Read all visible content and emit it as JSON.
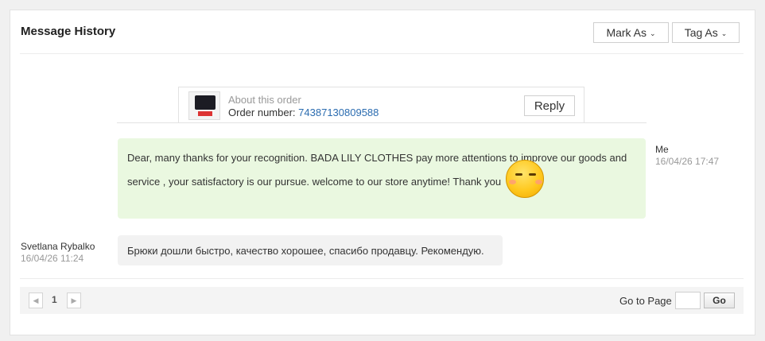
{
  "header": {
    "title": "Message History",
    "mark_as_label": "Mark As",
    "tag_as_label": "Tag As"
  },
  "order": {
    "about_label": "About this order",
    "order_number_label": "Order number:",
    "order_number": "74387130809588",
    "reply_label": "Reply"
  },
  "messages": [
    {
      "sender": "Me",
      "timestamp": "16/04/26 17:47",
      "text": "Dear, many thanks for your recognition. BADA LILY CLOTHES pay more attentions to improve our goods and service , your satisfactory is our pursue. welcome to our store anytime! Thank you",
      "icon": "smiley-emoji-icon"
    },
    {
      "sender": "Svetlana Rybalko",
      "timestamp": "16/04/26 11:24",
      "text": "Брюки дошли быстро, качество хорошее, спасибо продавцу. Рекомендую."
    }
  ],
  "pagination": {
    "current_page": "1",
    "goto_label": "Go to Page",
    "goto_value": "",
    "go_label": "Go"
  },
  "colors": {
    "my_bubble": "#eaf8e0",
    "buyer_bubble": "#f2f2f2",
    "link": "#2b6cb0"
  }
}
